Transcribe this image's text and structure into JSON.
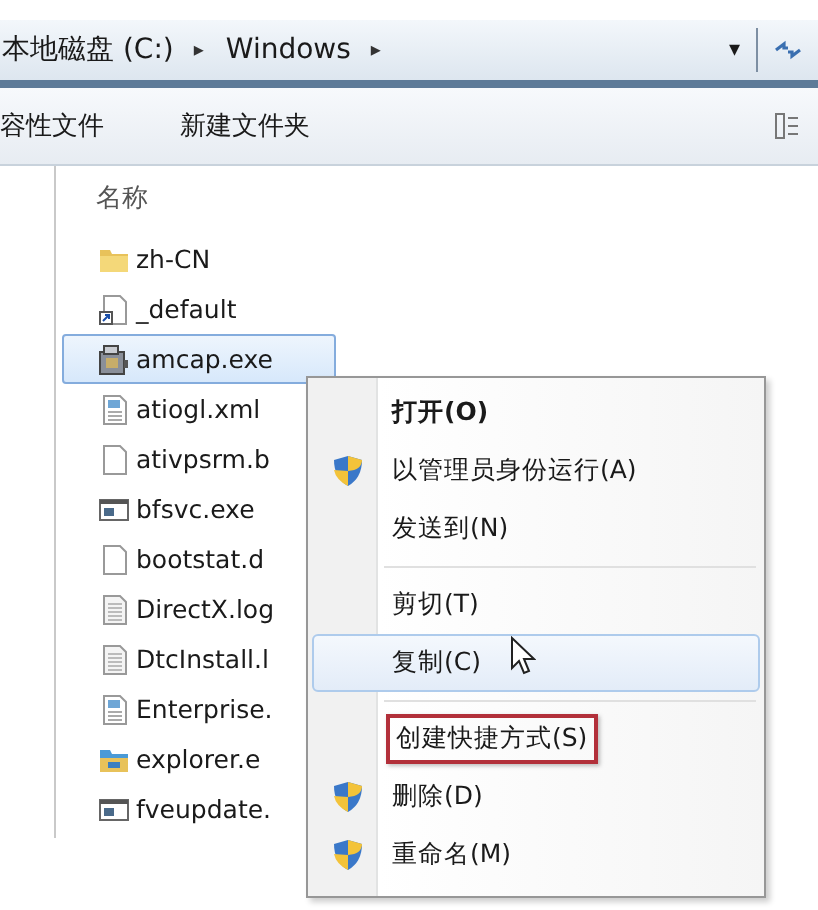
{
  "address_bar": {
    "crumbs": [
      "本地磁盘 (C:)",
      "Windows"
    ],
    "separator": "▸",
    "dropdown": "▾"
  },
  "toolbar": {
    "items": [
      "容性文件",
      "新建文件夹"
    ]
  },
  "file_list": {
    "column_header": "名称",
    "files": [
      {
        "name": "zh-CN",
        "kind": "folder",
        "selected": false
      },
      {
        "name": "_default",
        "kind": "shortcut",
        "selected": false
      },
      {
        "name": "amcap.exe",
        "kind": "app",
        "selected": true
      },
      {
        "name": "atiogl.xml",
        "kind": "config",
        "selected": false
      },
      {
        "name": "ativpsrm.b",
        "kind": "blank",
        "selected": false
      },
      {
        "name": "bfsvc.exe",
        "kind": "window",
        "selected": false
      },
      {
        "name": "bootstat.d",
        "kind": "blank",
        "selected": false
      },
      {
        "name": "DirectX.log",
        "kind": "text",
        "selected": false
      },
      {
        "name": "DtcInstall.l",
        "kind": "text",
        "selected": false
      },
      {
        "name": "Enterprise.",
        "kind": "config",
        "selected": false
      },
      {
        "name": "explorer.e",
        "kind": "explorer",
        "selected": false
      },
      {
        "name": "fveupdate.",
        "kind": "window",
        "selected": false
      }
    ]
  },
  "context_menu": {
    "items": [
      {
        "kind": "item",
        "label": "打开(O)",
        "default": true,
        "shield": false,
        "selected": false,
        "outlined": false
      },
      {
        "kind": "item",
        "label": "以管理员身份运行(A)",
        "default": false,
        "shield": true,
        "selected": false,
        "outlined": false
      },
      {
        "kind": "item",
        "label": "发送到(N)",
        "default": false,
        "shield": false,
        "selected": false,
        "outlined": false
      },
      {
        "kind": "separator"
      },
      {
        "kind": "item",
        "label": "剪切(T)",
        "default": false,
        "shield": false,
        "selected": false,
        "outlined": false
      },
      {
        "kind": "item",
        "label": "复制(C)",
        "default": false,
        "shield": false,
        "selected": true,
        "outlined": false
      },
      {
        "kind": "separator"
      },
      {
        "kind": "item",
        "label": "创建快捷方式(S)",
        "default": false,
        "shield": false,
        "selected": false,
        "outlined": true
      },
      {
        "kind": "item",
        "label": "删除(D)",
        "default": false,
        "shield": true,
        "selected": false,
        "outlined": false
      },
      {
        "kind": "item",
        "label": "重命名(M)",
        "default": false,
        "shield": true,
        "selected": false,
        "outlined": false
      }
    ]
  }
}
